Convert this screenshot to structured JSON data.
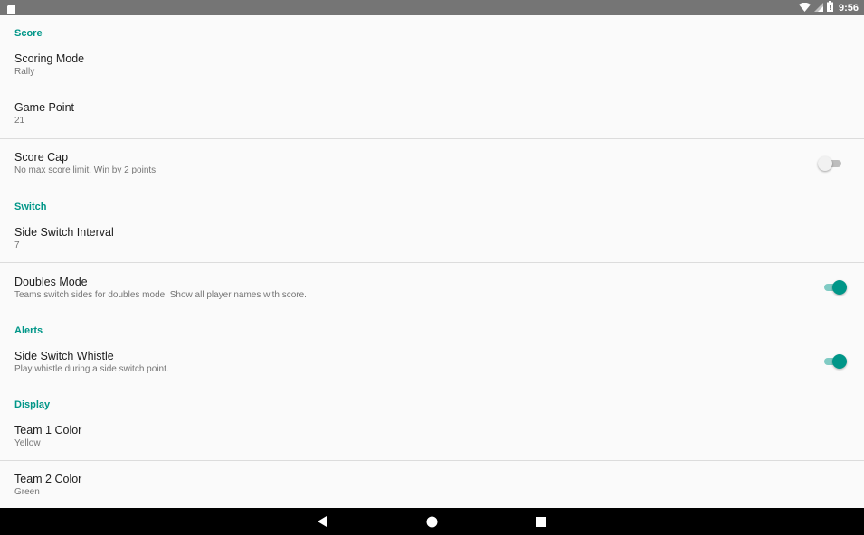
{
  "status_bar": {
    "time": "9:56",
    "icons": [
      "sd-card-icon",
      "wifi-icon",
      "signal-icon",
      "battery-icon"
    ]
  },
  "colors": {
    "accent": "#009688",
    "status_bar": "#757575",
    "nav_bar": "#000000",
    "background": "#fafafa"
  },
  "settings": {
    "score": {
      "header": "Score",
      "scoring_mode": {
        "title": "Scoring Mode",
        "summary": "Rally"
      },
      "game_point": {
        "title": "Game Point",
        "summary": "21"
      },
      "score_cap": {
        "title": "Score Cap",
        "summary": "No max score limit. Win by 2 points.",
        "enabled": false
      }
    },
    "switch": {
      "header": "Switch",
      "side_switch_interval": {
        "title": "Side Switch Interval",
        "summary": "7"
      },
      "doubles_mode": {
        "title": "Doubles Mode",
        "summary": "Teams switch sides for doubles mode. Show all player names with score.",
        "enabled": true
      }
    },
    "alerts": {
      "header": "Alerts",
      "side_switch_whistle": {
        "title": "Side Switch Whistle",
        "summary": "Play whistle during a side switch point.",
        "enabled": true
      }
    },
    "display": {
      "header": "Display",
      "team1_color": {
        "title": "Team 1 Color",
        "summary": "Yellow"
      },
      "team2_color": {
        "title": "Team 2 Color",
        "summary": "Green"
      }
    }
  },
  "nav_bar": {
    "buttons": [
      "back-icon",
      "home-icon",
      "recents-icon"
    ]
  }
}
